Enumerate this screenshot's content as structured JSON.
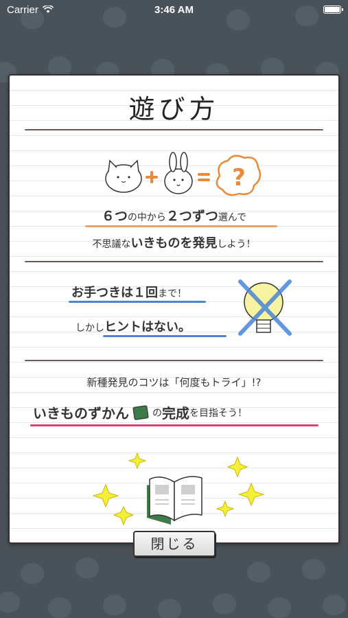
{
  "status_bar": {
    "carrier": "Carrier",
    "time": "3:46 AM"
  },
  "dialog": {
    "title": "遊び方",
    "section1": {
      "line1_a": "６つ",
      "line1_b": "の中から",
      "line1_c": "２つずつ",
      "line1_d": "選んで",
      "line2_a": "不思議な",
      "line2_b": "いきものを発見",
      "line2_c": "しよう！"
    },
    "section2": {
      "line1_a": "お手つきは１回",
      "line1_b": "まで！",
      "line2_a": "しかし",
      "line2_b": "ヒントはない。"
    },
    "section3": {
      "line1": "新種発見のコツは「何度もトライ」!?",
      "line2_a": "いきものずかん",
      "line2_b": "の",
      "line2_c": "完成",
      "line2_d": "を目指そう！"
    },
    "close_label": "閉じる"
  },
  "colors": {
    "background": "#4a5259",
    "orange_accent": "#f0a060",
    "blue_accent": "#4a86d8",
    "pink_accent": "#e0407a",
    "star_yellow": "#f5ef3a"
  }
}
